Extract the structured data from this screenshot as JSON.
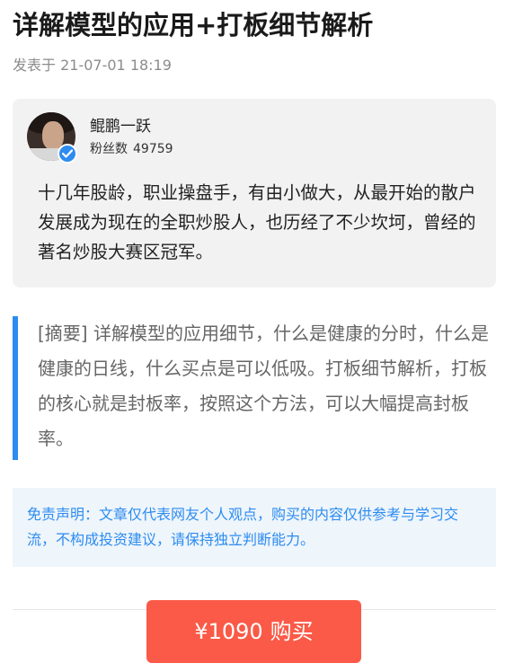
{
  "article": {
    "title": "详解模型的应用+打板细节解析",
    "published_label": "发表于",
    "published_date": "21-07-01 18:19"
  },
  "author": {
    "name": "鲲鹏一跃",
    "fans_label": "粉丝数",
    "fans_count": "49759",
    "bio": "十几年股龄，职业操盘手，有由小做大，从最开始的散户发展成为现在的全职炒股人，也历经了不少坎坷，曾经的著名炒股大赛区冠军。",
    "verified_icon": "verified-check-icon"
  },
  "summary": {
    "text": "[摘要] 详解模型的应用细节，什么是健康的分时，什么是健康的日线，什么买点是可以低吸。打板细节解析，打板的核心就是封板率，按照这个方法，可以大幅提高封板率。"
  },
  "disclaimer": {
    "text": "免责声明：文章仅代表网友个人观点，购买的内容仅供参考与学习交流，不构成投资建议，请保持独立判断能力。"
  },
  "purchase": {
    "price": "¥1090",
    "label": "购买"
  },
  "colors": {
    "accent_blue": "#2d8cf0",
    "buy_button": "#fa5a47",
    "card_bg": "#f2f2f3",
    "disclaimer_bg": "#eef5fb"
  }
}
